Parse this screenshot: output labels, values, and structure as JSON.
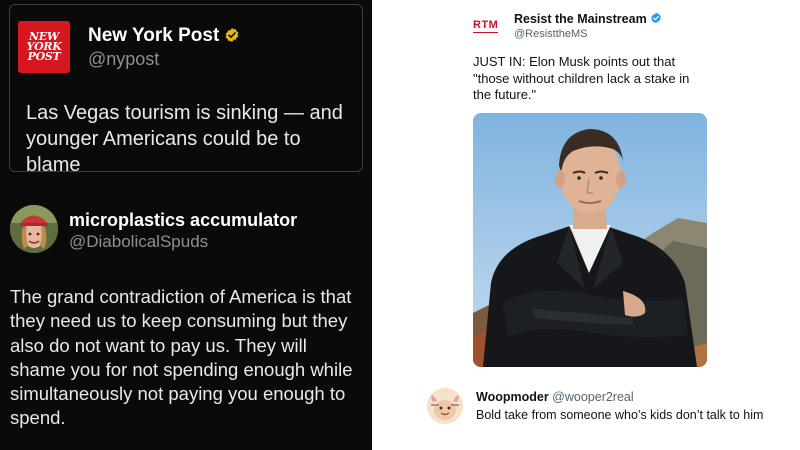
{
  "left_panel": {
    "quoted_post": {
      "logo_text": [
        "NEW",
        "YORK",
        "POST"
      ],
      "author_name": "New York Post",
      "author_handle": "@nypost",
      "verified_badge": "gold-check-icon",
      "text": "Las Vegas tourism is sinking — and younger Americans could be to blame"
    },
    "reply_post": {
      "author_name": "microplastics accumulator",
      "author_handle": "@DiabolicalSpuds",
      "text": "The grand contradiction of America is that they need us to keep consuming but they also do not want to pay us. They will shame you for not spending enough while simultaneously not paying you enough to spend."
    }
  },
  "right_panel": {
    "main_post": {
      "logo_text": "RTM",
      "author_name": "Resist the Mainstream",
      "author_handle": "@ResisttheMS",
      "verified_badge": "blue-check-icon",
      "text": "JUST IN: Elon Musk points out that\n\"those without children lack a stake in\nthe future.\""
    },
    "reply_post": {
      "author_name": "Woopmoder",
      "author_handle": "@wooper2real",
      "text": "Bold take from someone who’s kids don’t talk to him"
    }
  },
  "colors": {
    "left_bg": "#0a0a0a",
    "right_bg": "#ffffff",
    "nypost_red": "#d7171f",
    "rtm_red": "#c8102e",
    "verified_gold": "#e2b719",
    "verified_blue": "#1d9bf0"
  }
}
